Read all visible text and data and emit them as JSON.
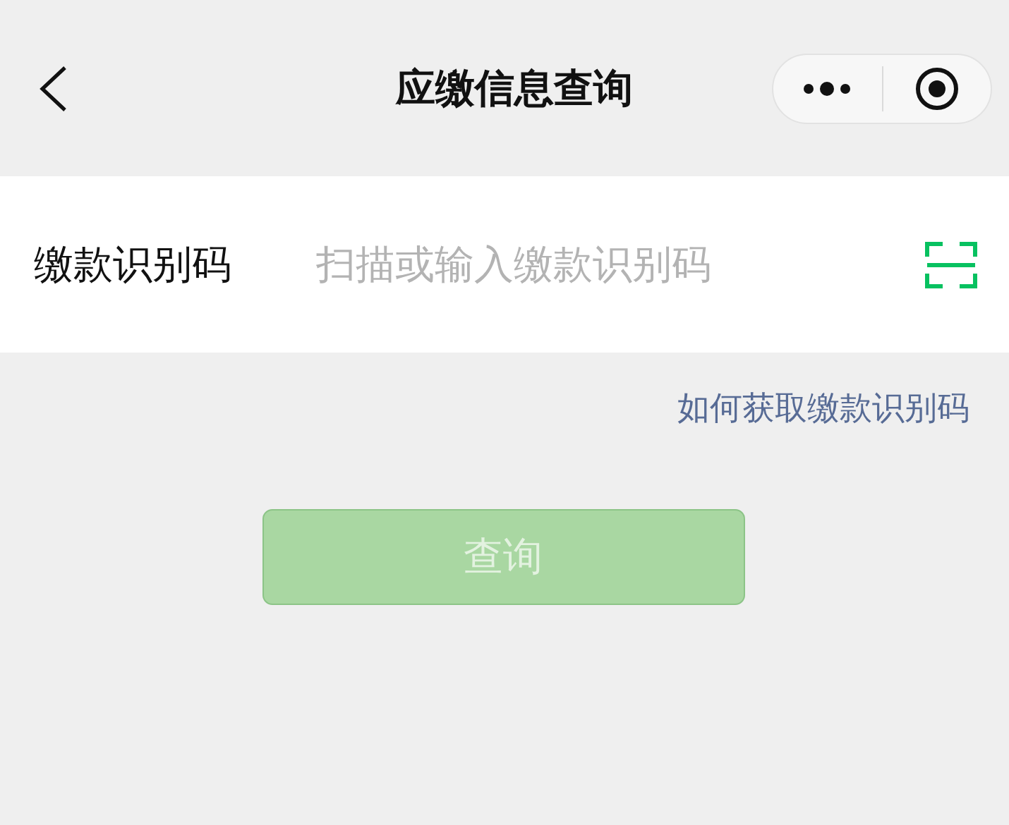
{
  "header": {
    "title": "应缴信息查询"
  },
  "field": {
    "label": "缴款识别码",
    "placeholder": "扫描或输入缴款识别码"
  },
  "help_link": "如何获取缴款识别码",
  "submit": {
    "label": "查询",
    "disabled": true
  }
}
